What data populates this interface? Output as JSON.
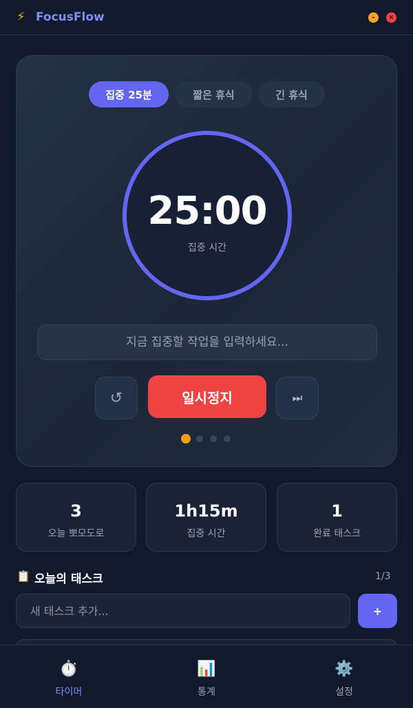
{
  "app": {
    "icon": "lightning-icon",
    "title": "FocusFlow",
    "window_controls": {
      "minimize": "–",
      "close": "×"
    }
  },
  "timer": {
    "modes": [
      {
        "label": "집중 25분",
        "active": true
      },
      {
        "label": "짧은 휴식",
        "active": false
      },
      {
        "label": "긴 휴식",
        "active": false
      }
    ],
    "time": "25:00",
    "label": "집중 시간",
    "task_placeholder": "지금 집중할 작업을 입력하세요...",
    "reset_icon": "↺",
    "primary_label": "일시정지",
    "skip_icon": "⏭",
    "session_dots": {
      "total": 4,
      "current": 1
    }
  },
  "stats": [
    {
      "value": "3",
      "label": "오늘 뽀모도로"
    },
    {
      "value": "1h15m",
      "label": "집중 시간"
    },
    {
      "value": "1",
      "label": "완료 태스크"
    }
  ],
  "tasks": {
    "icon": "📋",
    "title": "오늘의 태스크",
    "count": "1/3",
    "input_placeholder": "새 태스크 추가...",
    "add_label": "+"
  },
  "nav": [
    {
      "icon": "⏱️",
      "label": "타이머",
      "active": true
    },
    {
      "icon": "📊",
      "label": "통계",
      "active": false
    },
    {
      "icon": "⚙️",
      "label": "설정",
      "active": false
    }
  ],
  "colors": {
    "accent": "#6366f1",
    "danger": "#ef4444",
    "warning": "#f59e0b",
    "background": "#111a2d"
  }
}
